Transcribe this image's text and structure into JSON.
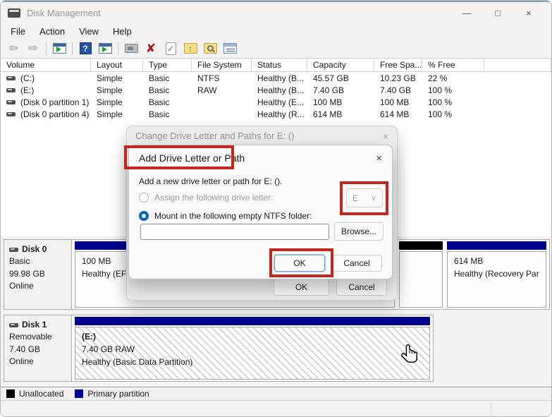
{
  "window": {
    "title": "Disk Management",
    "minimize_glyph": "—",
    "maximize_glyph": "□",
    "close_glyph": "×"
  },
  "menu": {
    "file": "File",
    "action": "Action",
    "view": "View",
    "help": "Help"
  },
  "toolbar": {
    "back_glyph": "⇦",
    "forward_glyph": "⇨",
    "help_glyph": "?",
    "delete_glyph": "✘",
    "check_glyph": "✓",
    "up_glyph": "↑",
    "icons": [
      "back-icon",
      "forward-icon",
      "console-tree-icon",
      "help-icon",
      "show-window-icon",
      "display-icon",
      "delete-icon",
      "properties-icon",
      "open-folder-icon",
      "search-folder-icon",
      "checklist-icon"
    ]
  },
  "volume_table": {
    "columns": {
      "volume": "Volume",
      "layout": "Layout",
      "type": "Type",
      "fs": "File System",
      "status": "Status",
      "capacity": "Capacity",
      "free": "Free Spa...",
      "pct": "% Free"
    },
    "rows": [
      {
        "volume": "(C:)",
        "layout": "Simple",
        "type": "Basic",
        "fs": "NTFS",
        "status": "Healthy (B...",
        "capacity": "45.57 GB",
        "free": "10.23 GB",
        "pct": "22 %"
      },
      {
        "volume": "(E:)",
        "layout": "Simple",
        "type": "Basic",
        "fs": "RAW",
        "status": "Healthy (B...",
        "capacity": "7.40 GB",
        "free": "7.40 GB",
        "pct": "100 %"
      },
      {
        "volume": "(Disk 0 partition 1)",
        "layout": "Simple",
        "type": "Basic",
        "fs": "",
        "status": "Healthy (E...",
        "capacity": "100 MB",
        "free": "100 MB",
        "pct": "100 %"
      },
      {
        "volume": "(Disk 0 partition 4)",
        "layout": "Simple",
        "type": "Basic",
        "fs": "",
        "status": "Healthy (R...",
        "capacity": "614 MB",
        "free": "614 MB",
        "pct": "100 %"
      }
    ]
  },
  "disks": {
    "disk0": {
      "name": "Disk 0",
      "type": "Basic",
      "size": "99.98 GB",
      "status": "Online",
      "efi": {
        "size": "100 MB",
        "status": "Healthy (EFI"
      },
      "recovery": {
        "size": "614 MB",
        "status": "Healthy (Recovery Par"
      }
    },
    "disk1": {
      "name": "Disk 1",
      "type": "Removable",
      "size": "7.40 GB",
      "status": "Online",
      "part": {
        "label": "(E:)",
        "size_fs": "7.40 GB RAW",
        "status": "Healthy (Basic Data Partition)"
      }
    }
  },
  "legend": {
    "unallocated": "Unallocated",
    "primary": "Primary partition"
  },
  "dialog_outer": {
    "title": "Change Drive Letter and Paths for E: ()",
    "close_glyph": "×",
    "ok": "OK",
    "cancel": "Cancel"
  },
  "dialog_inner": {
    "title": "Add Drive Letter or Path",
    "close_glyph": "×",
    "description": "Add a new drive letter or path for E: ().",
    "radio_assign": "Assign the following drive letter:",
    "drive_letter": "E",
    "chevron_glyph": "∨",
    "radio_mount": "Mount in the following empty NTFS folder:",
    "path_value": "",
    "browse": "Browse...",
    "ok": "OK",
    "cancel": "Cancel"
  },
  "colors": {
    "primary_partition": "#000090",
    "unallocated": "#000000",
    "annotation": "#c3271b",
    "radio_accent": "#0067c0"
  }
}
